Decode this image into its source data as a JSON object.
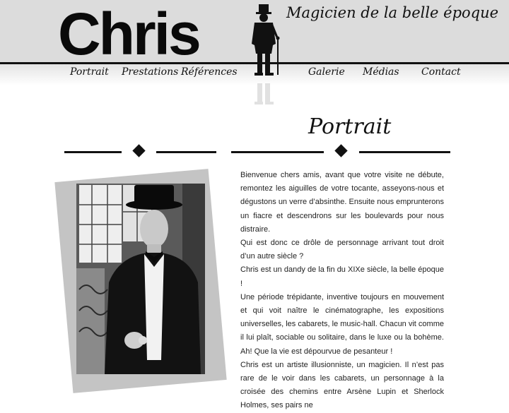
{
  "header": {
    "logo_text": "Chris",
    "tagline": "Magicien de la belle époque"
  },
  "nav": {
    "items": [
      {
        "label": "Portrait"
      },
      {
        "label": "Prestations"
      },
      {
        "label": "Références"
      },
      {
        "label": "Galerie"
      },
      {
        "label": "Médias"
      },
      {
        "label": "Contact"
      }
    ]
  },
  "main": {
    "title": "Portrait",
    "paragraphs": [
      "Bienvenue chers amis, avant que votre visite ne débute, remontez les aiguilles de votre tocante, asseyons-nous et dégustons un verre d’absinthe. Ensuite nous emprunterons un fiacre et descendrons sur les boulevards pour nous distraire.",
      "Qui est donc ce drôle de personnage arrivant tout droit d’un autre siècle ?",
      "Chris est un dandy de la fin du XIXe siècle, la belle époque !",
      "Une période trépidante, inventive toujours en mouvement et qui voit naître le cinématographe, les expositions universelles, les cabarets, le music-hall. Chacun vit comme il lui plaît, sociable ou solitaire, dans le luxe ou la bohème. Ah! Que la vie est dépourvue de pesanteur !",
      "Chris est un artiste illusionniste, un magicien. Il n’est pas rare de le voir dans les cabarets, un personnage à la croisée des chemins entre Arsène Lupin et Sherlock Holmes, ses pairs ne"
    ]
  },
  "colors": {
    "header_bg": "#dcdcdc",
    "ink": "#111111",
    "text": "#222222"
  }
}
